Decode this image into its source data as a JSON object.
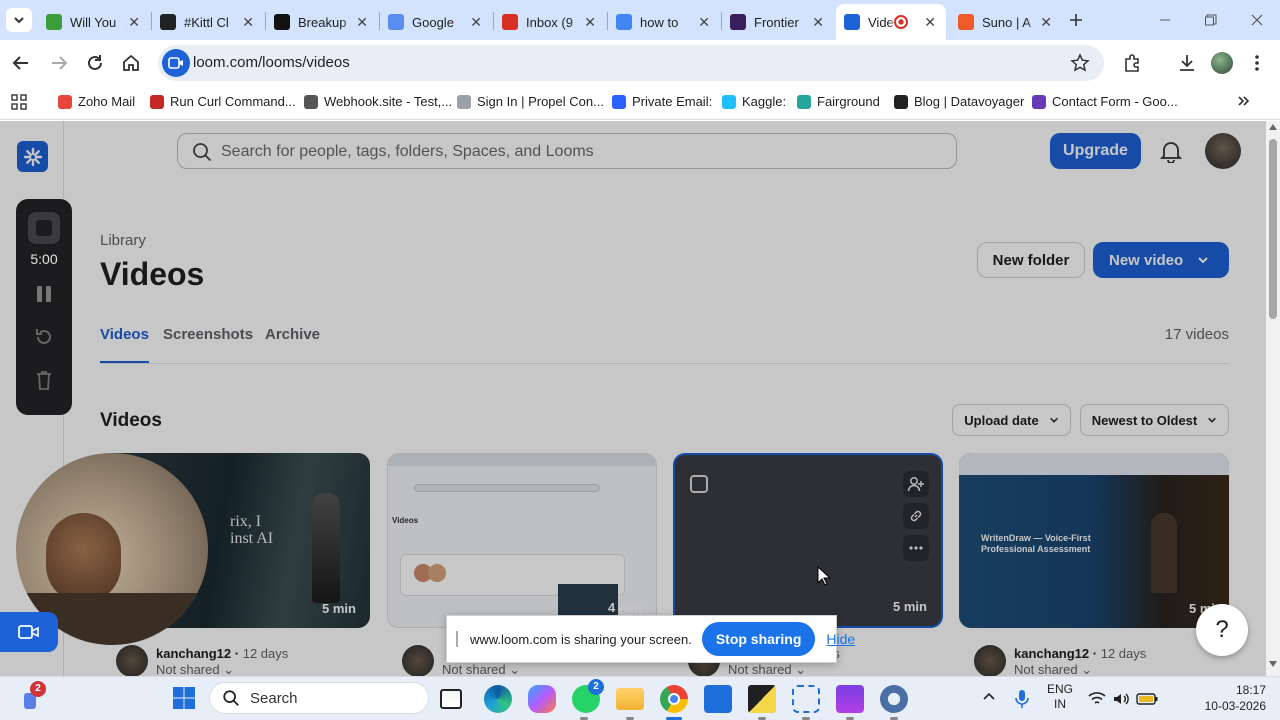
{
  "browser": {
    "tabs": [
      {
        "label": "Will You",
        "color": "#3c9d3a"
      },
      {
        "label": "#Kittl Cl",
        "color": "#202124"
      },
      {
        "label": "Breakup",
        "color": "#111111"
      },
      {
        "label": "Google",
        "color": "#5b8def"
      },
      {
        "label": "Inbox (9",
        "color": "#d93025"
      },
      {
        "label": "how to",
        "color": "#4285f4"
      },
      {
        "label": "Frontier",
        "color": "#3a1e5c"
      },
      {
        "label": "Vide",
        "color": "#1d62d6"
      },
      {
        "label": "Suno | A",
        "color": "#f05a28"
      }
    ],
    "url": "loom.com/looms/videos",
    "bookmarks": [
      {
        "label": "Zoho Mail",
        "color": "#e8453c"
      },
      {
        "label": "Run Curl Command...",
        "color": "#c62828"
      },
      {
        "label": "Webhook.site - Test,...",
        "color": "#555555"
      },
      {
        "label": "Sign In | Propel Con...",
        "color": "#9aa0a6"
      },
      {
        "label": "Private Email:",
        "color": "#2962ff"
      },
      {
        "label": "Kaggle:",
        "color": "#20beff"
      },
      {
        "label": "Fairground",
        "color": "#26a69a"
      },
      {
        "label": "Blog | Datavoyager",
        "color": "#222222"
      },
      {
        "label": "Contact Form - Goo...",
        "color": "#673ab7"
      }
    ]
  },
  "loom": {
    "search_placeholder": "Search for people, tags, folders, Spaces, and Looms",
    "upgrade_label": "Upgrade",
    "breadcrumb": "Library",
    "title": "Videos",
    "new_folder_label": "New folder",
    "new_video_label": "New video",
    "tabs": [
      "Videos",
      "Screenshots",
      "Archive"
    ],
    "video_count": "17 videos",
    "section_title": "Videos",
    "sort_field": "Upload date",
    "sort_order": "Newest to Oldest",
    "recorder_time": "5:00",
    "cards": [
      {
        "thumb_text": "rix, I\ninst AI",
        "duration": "5 min",
        "owner": "kanchang12",
        "age": "12 days",
        "share": "Not shared"
      },
      {
        "thumb_text": "Videos",
        "duration": "4 min",
        "owner": "",
        "age": "",
        "share": "Not shared"
      },
      {
        "thumb_text": "",
        "duration": "5 min",
        "owner": "",
        "age": "hs",
        "share": "Not shared"
      },
      {
        "thumb_text": "WritenDraw — Voice-First Professional Assessment",
        "duration": "5 mi",
        "owner": "kanchang12",
        "age": "12 days",
        "share": "Not shared"
      }
    ],
    "help_label": "?"
  },
  "share_bar": {
    "message": "www.loom.com is sharing your screen.",
    "stop_label": "Stop sharing",
    "hide_label": "Hide"
  },
  "taskbar": {
    "badge": "2",
    "search_label": "Search",
    "whatsapp_badge": "2",
    "lang_top": "ENG",
    "lang_bottom": "IN",
    "time": "18:17",
    "date": "10-03-2026"
  }
}
